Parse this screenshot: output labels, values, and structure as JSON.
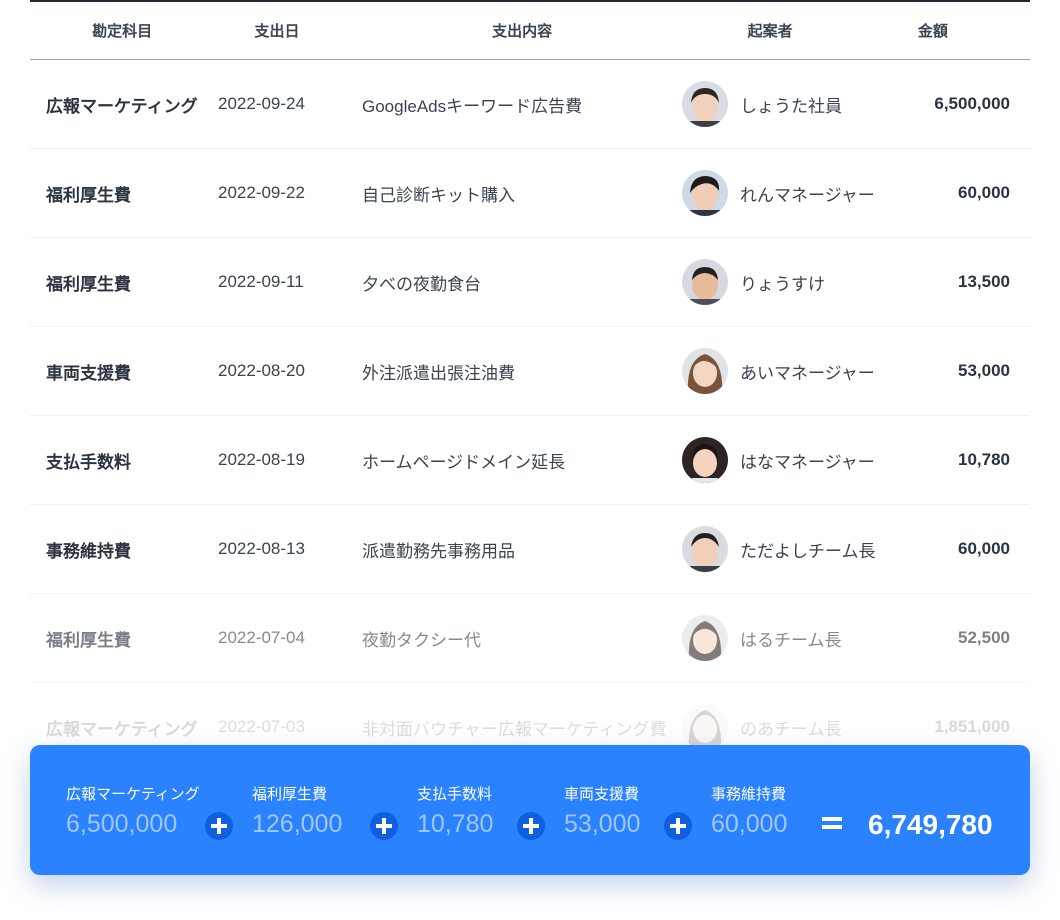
{
  "headers": {
    "category": "勘定科目",
    "date": "支出日",
    "description": "支出内容",
    "applicant": "起案者",
    "amount": "金額"
  },
  "rows": [
    {
      "category": "広報マーケティング",
      "date": "2022-09-24",
      "description": "GoogleAdsキーワード広告費",
      "applicant": "しょうた社員",
      "amount": "6,500,000"
    },
    {
      "category": "福利厚生費",
      "date": "2022-09-22",
      "description": "自己診断キット購入",
      "applicant": "れんマネージャー",
      "amount": "60,000"
    },
    {
      "category": "福利厚生費",
      "date": "2022-09-11",
      "description": "夕べの夜勤食台",
      "applicant": "りょうすけ",
      "amount": "13,500"
    },
    {
      "category": "車両支援費",
      "date": "2022-08-20",
      "description": "外注派遣出張注油費",
      "applicant": "あいマネージャー",
      "amount": "53,000"
    },
    {
      "category": "支払手数料",
      "date": "2022-08-19",
      "description": "ホームページドメイン延長",
      "applicant": "はなマネージャー",
      "amount": "10,780"
    },
    {
      "category": "事務維持費",
      "date": "2022-08-13",
      "description": "派遣勤務先事務用品",
      "applicant": "ただよしチーム長",
      "amount": "60,000"
    },
    {
      "category": "福利厚生費",
      "date": "2022-07-04",
      "description": "夜勤タクシー代",
      "applicant": "はるチーム長",
      "amount": "52,500"
    },
    {
      "category": "広報マーケティング",
      "date": "2022-07-03",
      "description": "非対面バウチャー広報マーケティング費",
      "applicant": "のあチーム長",
      "amount": "1,851,000"
    }
  ],
  "summary": {
    "items": [
      {
        "label": "広報マーケティング",
        "value": "6,500,000"
      },
      {
        "label": "福利厚生費",
        "value": "126,000"
      },
      {
        "label": "支払手数料",
        "value": "10,780"
      },
      {
        "label": "車両支援費",
        "value": "53,000"
      },
      {
        "label": "事務維持費",
        "value": "60,000"
      }
    ],
    "total": "6,749,780"
  },
  "colors": {
    "summary_bg": "#2a82ff",
    "plus_bg": "#0f5fe0",
    "text_dark": "#2b3440"
  }
}
